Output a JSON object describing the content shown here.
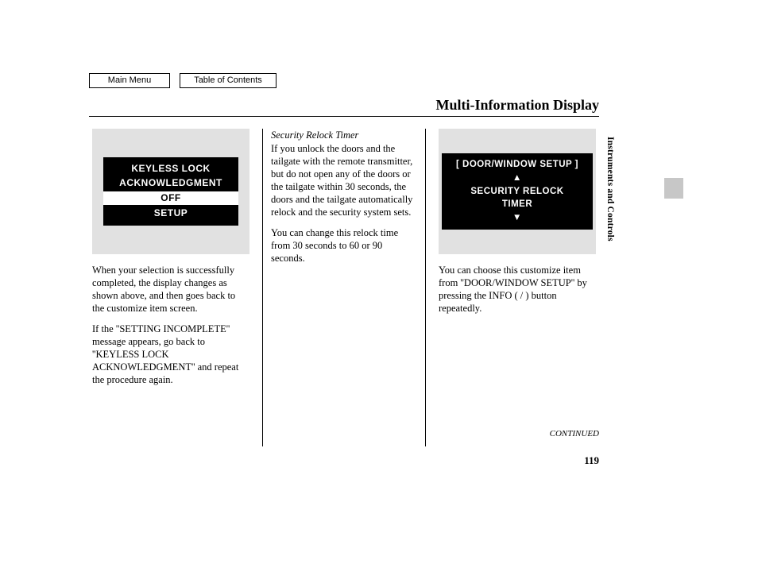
{
  "nav": {
    "main_menu": "Main Menu",
    "toc": "Table of Contents"
  },
  "title": "Multi-Information Display",
  "side_label": "Instruments and Controls",
  "continued": "CONTINUED",
  "page_number": "119",
  "col1": {
    "lcd": {
      "l1": "KEYLESS LOCK",
      "l2": "ACKNOWLEDGMENT",
      "l3": "OFF",
      "l4": "SETUP"
    },
    "p1": "When your selection is successfully completed, the display changes as shown above, and then goes back to the customize item screen.",
    "p2": "If the ''SETTING INCOMPLETE'' message appears, go back to ''KEYLESS LOCK ACKNOWLEDGMENT'' and repeat the procedure again."
  },
  "col2": {
    "subhead": "Security Relock Timer",
    "p1": "If you unlock the doors and the tailgate with the remote transmitter, but do not open any of the doors or the tailgate within 30 seconds, the doors and the tailgate automatically relock and the security system sets.",
    "p2": "You can change this relock time from 30 seconds to 60 or 90 seconds."
  },
  "col3": {
    "lcd": {
      "l1": "[ DOOR/WINDOW SETUP ]",
      "l2": "▲",
      "l3": "SECURITY RELOCK",
      "l4": "TIMER",
      "l5": "▼"
    },
    "p1": "You can choose this customize item from ''DOOR/WINDOW SETUP'' by pressing the INFO (    /    ) button repeatedly."
  }
}
